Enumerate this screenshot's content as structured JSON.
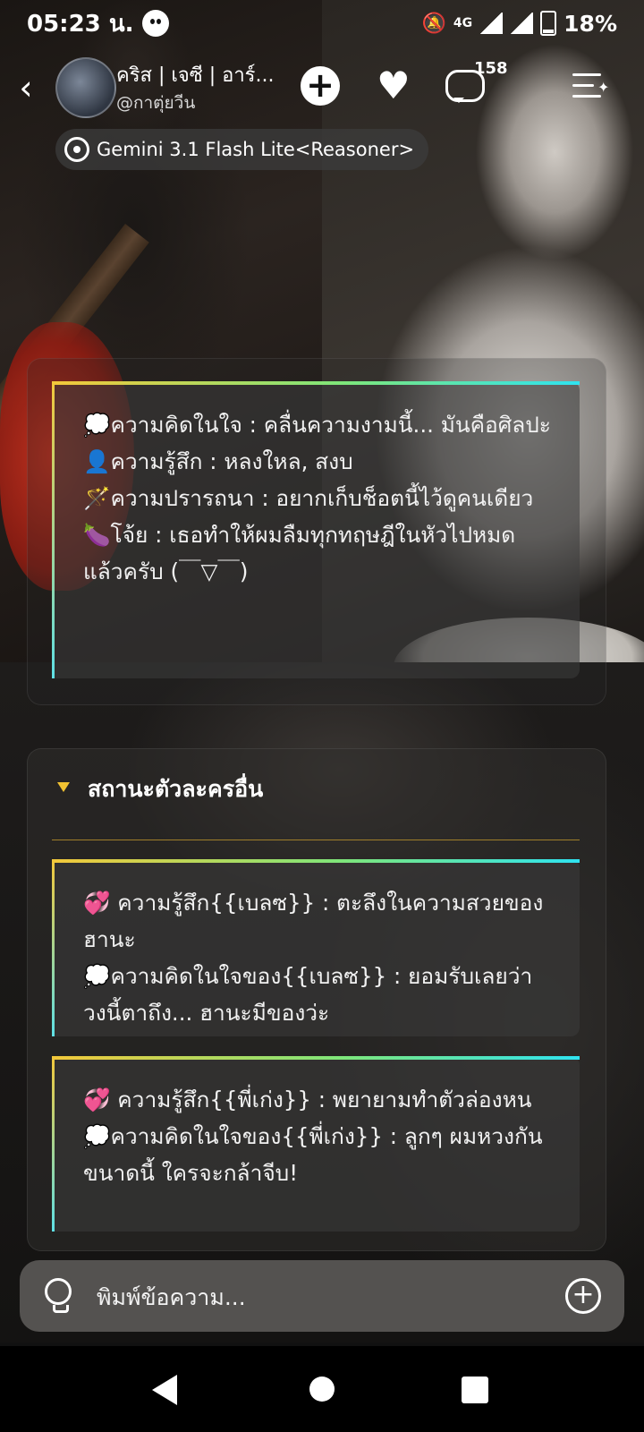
{
  "status_bar": {
    "time": "05:23 น.",
    "network": "4G",
    "battery": "18%"
  },
  "header": {
    "back_icon": "chevron-left-icon",
    "character_name": "คริส | เจซี | อาร์...",
    "handle": "@กาตุ่ยวีน",
    "comment_count": "158",
    "icons": [
      "plus-icon",
      "heart-icon",
      "comment-icon",
      "menu-sparkle-icon"
    ]
  },
  "model": {
    "label": "Gemini 3.1 Flash Lite<Reasoner>"
  },
  "main_card": {
    "lines": [
      "💭ความคิดในใจ : คลื่นความงามนี้... มันคือศิลปะ",
      "👤ความรู้สึก : หลงใหล, สงบ",
      "🪄ความปรารถนา : อยากเก็บช็อตนี้ไว้ดูคนเดียว",
      "🍆โจ้ย : เธอทำให้ผมลืมทุกทฤษฎีในหัวไปหมดแล้วครับ (￣▽￣)"
    ]
  },
  "other_characters": {
    "section_title": "สถานะตัวละครอื่น",
    "cards": [
      {
        "lines": [
          "💞 ความรู้สึก{{เบลซ}} : ตะลึงในความสวยของฮานะ",
          "💭ความคิดในใจของ{{เบลซ}} : ยอมรับเลยว่าวงนี้ตาถึง... ฮานะมีของว่ะ"
        ]
      },
      {
        "lines": [
          "💞 ความรู้สึก{{พี่เก่ง}} : พยายามทำตัวล่องหน",
          "💭ความคิดในใจของ{{พี่เก่ง}} : ลูกๆ ผมหวงกันขนาดนี้ ใครจะกล้าจีบ!"
        ]
      }
    ]
  },
  "input": {
    "placeholder": "พิมพ์ข้อความ..."
  },
  "colors": {
    "accent_yellow": "#f3c83a",
    "accent_cyan": "#2fe3f0",
    "accent_green": "#7ee67a"
  }
}
